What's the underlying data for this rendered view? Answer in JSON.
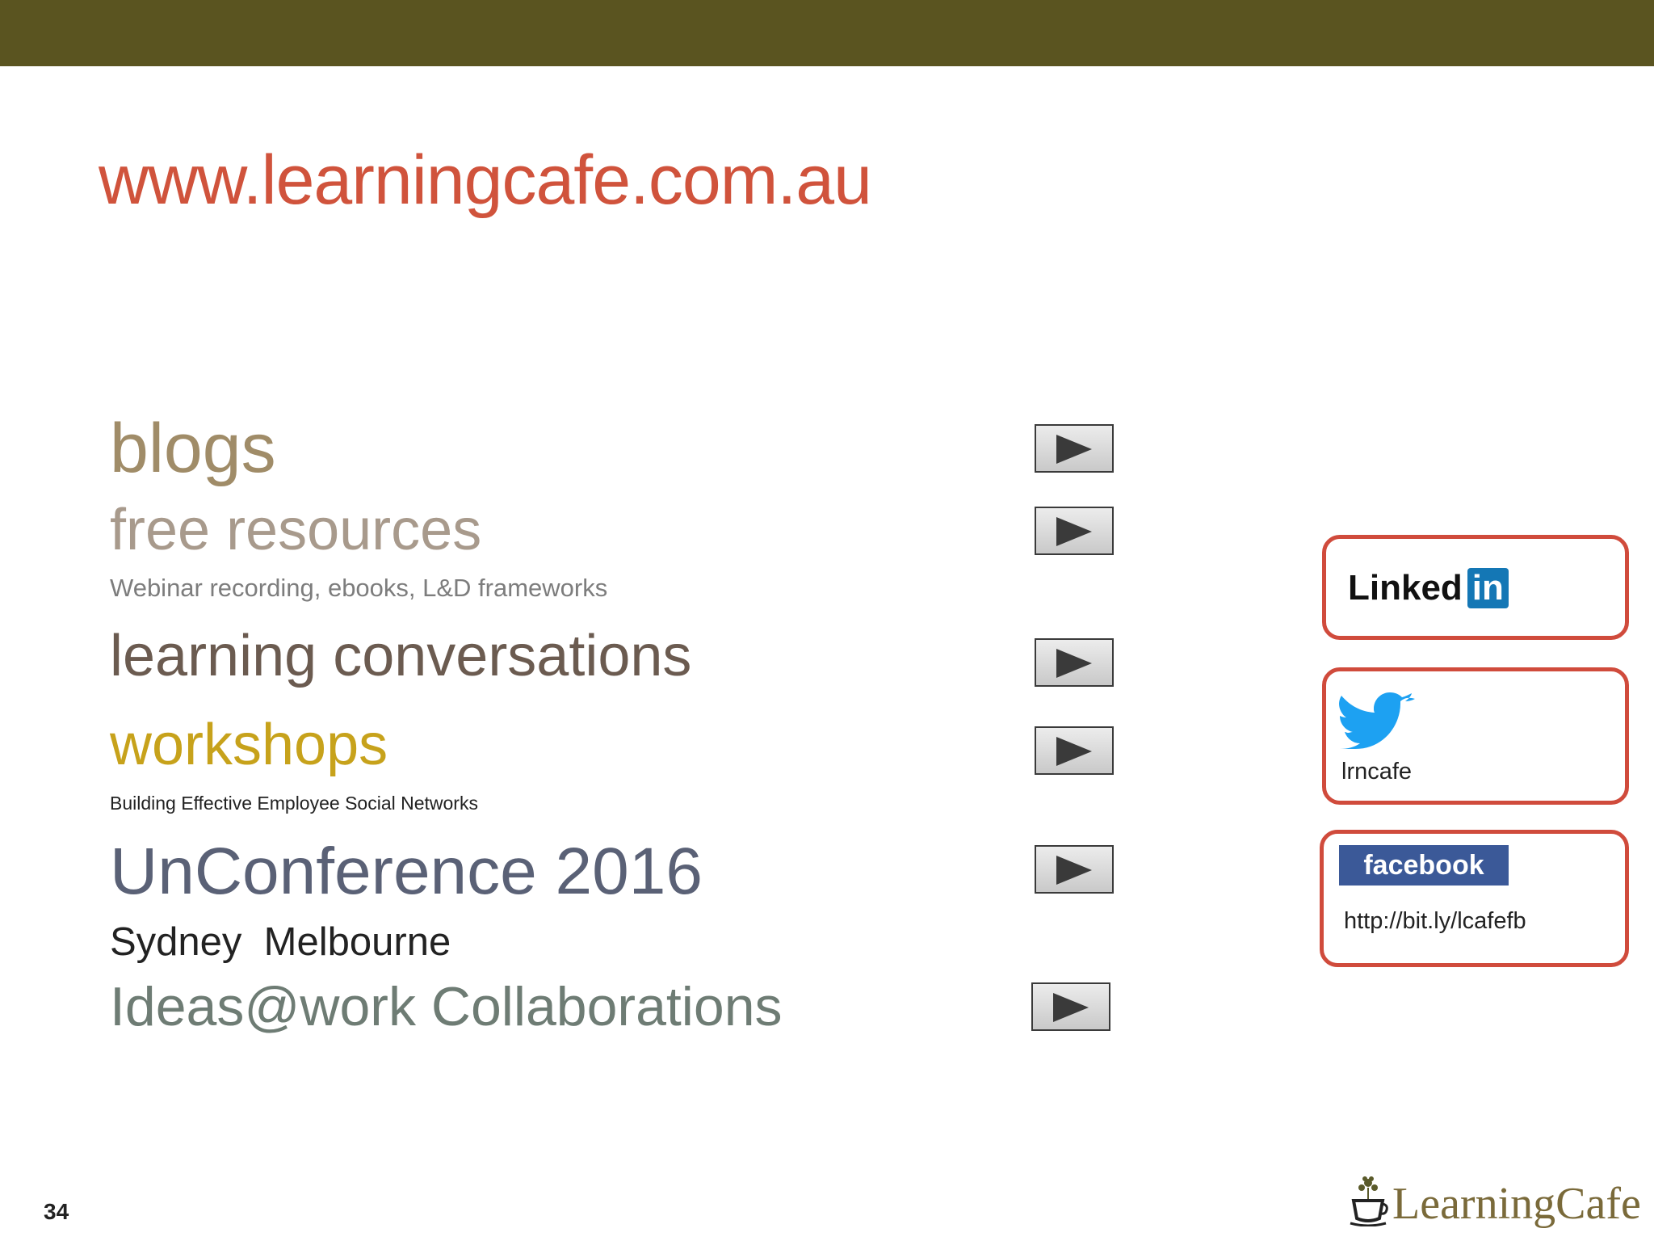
{
  "slide": {
    "url": "www.learningcafe.com.au",
    "page_number": "34",
    "brand_name": "LearningCafe"
  },
  "items": [
    {
      "id": "blogs",
      "label": "blogs",
      "color": "#a08c68"
    },
    {
      "id": "free_resources",
      "label": "free resources",
      "color": "#a89a8c"
    },
    {
      "id": "free_resources_sub",
      "label": "Webinar recording, ebooks, L&D frameworks",
      "color": "#7d7d7d"
    },
    {
      "id": "learning_conversations",
      "label": "learning conversations",
      "color": "#6b5b50"
    },
    {
      "id": "workshops",
      "label": "workshops",
      "color": "#c7a21b"
    },
    {
      "id": "workshops_sub",
      "label": "Building Effective Employee Social Networks",
      "color": "#222222"
    },
    {
      "id": "unconference",
      "label": "UnConference 2016",
      "color": "#5a6176"
    },
    {
      "id": "cities",
      "label": "Sydney  Melbourne",
      "color": "#222222"
    },
    {
      "id": "ideas",
      "label": "Ideas@work Collaborations",
      "color": "#6e7c74"
    }
  ],
  "social": {
    "linkedin": {
      "word": "Linked",
      "badge": "in"
    },
    "twitter": {
      "handle": "lrncafe"
    },
    "facebook": {
      "logo": "facebook",
      "link": "http://bit.ly/lcafefb"
    }
  },
  "icons": {
    "play": "play-icon",
    "twitter": "twitter-bird-icon",
    "brand": "coffee-cup-tree-icon"
  },
  "colors": {
    "top_bar": "#5a5420",
    "url": "#d0533c",
    "card_border": "#d04b3c",
    "linkedin_badge": "#1477b5",
    "facebook": "#3b5998",
    "twitter": "#1da1f2",
    "brand": "#7a6a3a"
  }
}
